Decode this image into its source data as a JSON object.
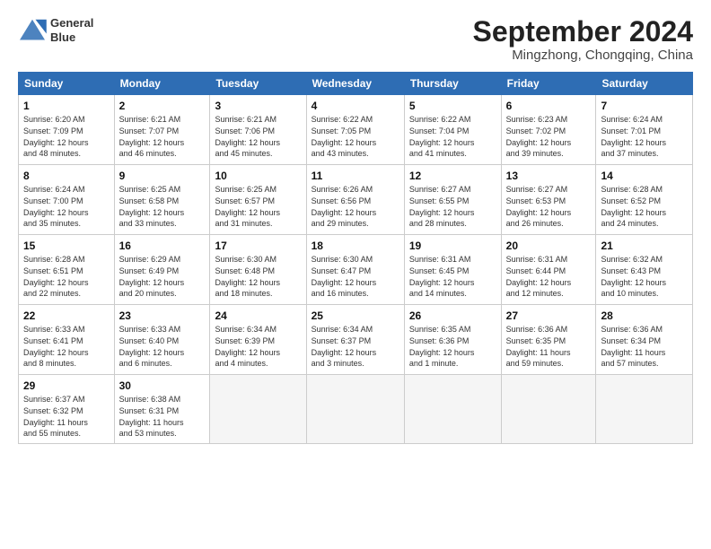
{
  "header": {
    "logo_line1": "General",
    "logo_line2": "Blue",
    "month_title": "September 2024",
    "location": "Mingzhong, Chongqing, China"
  },
  "weekdays": [
    "Sunday",
    "Monday",
    "Tuesday",
    "Wednesday",
    "Thursday",
    "Friday",
    "Saturday"
  ],
  "weeks": [
    [
      {
        "day": "1",
        "info": "Sunrise: 6:20 AM\nSunset: 7:09 PM\nDaylight: 12 hours\nand 48 minutes."
      },
      {
        "day": "2",
        "info": "Sunrise: 6:21 AM\nSunset: 7:07 PM\nDaylight: 12 hours\nand 46 minutes."
      },
      {
        "day": "3",
        "info": "Sunrise: 6:21 AM\nSunset: 7:06 PM\nDaylight: 12 hours\nand 45 minutes."
      },
      {
        "day": "4",
        "info": "Sunrise: 6:22 AM\nSunset: 7:05 PM\nDaylight: 12 hours\nand 43 minutes."
      },
      {
        "day": "5",
        "info": "Sunrise: 6:22 AM\nSunset: 7:04 PM\nDaylight: 12 hours\nand 41 minutes."
      },
      {
        "day": "6",
        "info": "Sunrise: 6:23 AM\nSunset: 7:02 PM\nDaylight: 12 hours\nand 39 minutes."
      },
      {
        "day": "7",
        "info": "Sunrise: 6:24 AM\nSunset: 7:01 PM\nDaylight: 12 hours\nand 37 minutes."
      }
    ],
    [
      {
        "day": "8",
        "info": "Sunrise: 6:24 AM\nSunset: 7:00 PM\nDaylight: 12 hours\nand 35 minutes."
      },
      {
        "day": "9",
        "info": "Sunrise: 6:25 AM\nSunset: 6:58 PM\nDaylight: 12 hours\nand 33 minutes."
      },
      {
        "day": "10",
        "info": "Sunrise: 6:25 AM\nSunset: 6:57 PM\nDaylight: 12 hours\nand 31 minutes."
      },
      {
        "day": "11",
        "info": "Sunrise: 6:26 AM\nSunset: 6:56 PM\nDaylight: 12 hours\nand 29 minutes."
      },
      {
        "day": "12",
        "info": "Sunrise: 6:27 AM\nSunset: 6:55 PM\nDaylight: 12 hours\nand 28 minutes."
      },
      {
        "day": "13",
        "info": "Sunrise: 6:27 AM\nSunset: 6:53 PM\nDaylight: 12 hours\nand 26 minutes."
      },
      {
        "day": "14",
        "info": "Sunrise: 6:28 AM\nSunset: 6:52 PM\nDaylight: 12 hours\nand 24 minutes."
      }
    ],
    [
      {
        "day": "15",
        "info": "Sunrise: 6:28 AM\nSunset: 6:51 PM\nDaylight: 12 hours\nand 22 minutes."
      },
      {
        "day": "16",
        "info": "Sunrise: 6:29 AM\nSunset: 6:49 PM\nDaylight: 12 hours\nand 20 minutes."
      },
      {
        "day": "17",
        "info": "Sunrise: 6:30 AM\nSunset: 6:48 PM\nDaylight: 12 hours\nand 18 minutes."
      },
      {
        "day": "18",
        "info": "Sunrise: 6:30 AM\nSunset: 6:47 PM\nDaylight: 12 hours\nand 16 minutes."
      },
      {
        "day": "19",
        "info": "Sunrise: 6:31 AM\nSunset: 6:45 PM\nDaylight: 12 hours\nand 14 minutes."
      },
      {
        "day": "20",
        "info": "Sunrise: 6:31 AM\nSunset: 6:44 PM\nDaylight: 12 hours\nand 12 minutes."
      },
      {
        "day": "21",
        "info": "Sunrise: 6:32 AM\nSunset: 6:43 PM\nDaylight: 12 hours\nand 10 minutes."
      }
    ],
    [
      {
        "day": "22",
        "info": "Sunrise: 6:33 AM\nSunset: 6:41 PM\nDaylight: 12 hours\nand 8 minutes."
      },
      {
        "day": "23",
        "info": "Sunrise: 6:33 AM\nSunset: 6:40 PM\nDaylight: 12 hours\nand 6 minutes."
      },
      {
        "day": "24",
        "info": "Sunrise: 6:34 AM\nSunset: 6:39 PM\nDaylight: 12 hours\nand 4 minutes."
      },
      {
        "day": "25",
        "info": "Sunrise: 6:34 AM\nSunset: 6:37 PM\nDaylight: 12 hours\nand 3 minutes."
      },
      {
        "day": "26",
        "info": "Sunrise: 6:35 AM\nSunset: 6:36 PM\nDaylight: 12 hours\nand 1 minute."
      },
      {
        "day": "27",
        "info": "Sunrise: 6:36 AM\nSunset: 6:35 PM\nDaylight: 11 hours\nand 59 minutes."
      },
      {
        "day": "28",
        "info": "Sunrise: 6:36 AM\nSunset: 6:34 PM\nDaylight: 11 hours\nand 57 minutes."
      }
    ],
    [
      {
        "day": "29",
        "info": "Sunrise: 6:37 AM\nSunset: 6:32 PM\nDaylight: 11 hours\nand 55 minutes."
      },
      {
        "day": "30",
        "info": "Sunrise: 6:38 AM\nSunset: 6:31 PM\nDaylight: 11 hours\nand 53 minutes."
      },
      {
        "day": "",
        "info": ""
      },
      {
        "day": "",
        "info": ""
      },
      {
        "day": "",
        "info": ""
      },
      {
        "day": "",
        "info": ""
      },
      {
        "day": "",
        "info": ""
      }
    ]
  ]
}
